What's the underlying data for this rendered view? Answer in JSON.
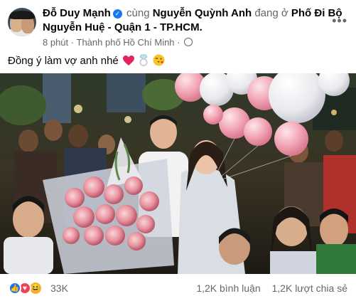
{
  "post": {
    "author": "Đỗ Duy Mạnh",
    "with_text": "cùng",
    "tagged": "Nguyễn Quỳnh Anh",
    "at_text": "đang ở",
    "place": "Phố Đi Bộ Nguyễn Huệ - Quận 1 - TP.HCM.",
    "time": "8 phút",
    "separator": "·",
    "location": "Thành phố Hồ Chí Minh",
    "caption": "Đồng ý làm vợ anh nhé",
    "more_icon": "more-options-icon"
  },
  "reactions": {
    "icons": [
      "like-icon",
      "love-icon",
      "haha-icon"
    ],
    "count": "33K",
    "comments": "1,2K bình luận",
    "shares": "1,2K lượt chia sẻ"
  },
  "colors": {
    "like": "#1877f2",
    "love": "#f33e58",
    "haha": "#f7b125",
    "verified": "#1877f2"
  }
}
